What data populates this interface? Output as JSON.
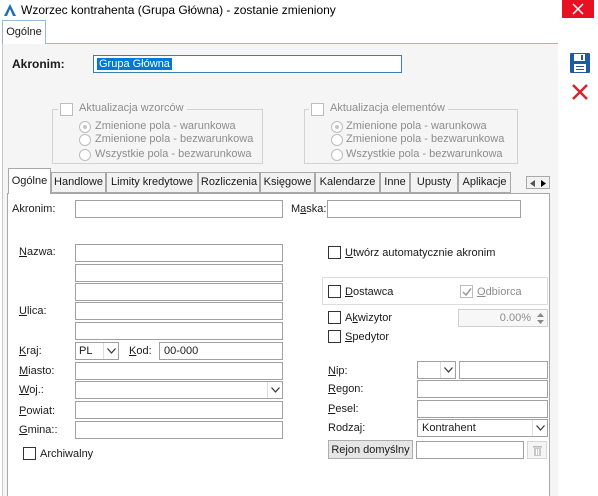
{
  "window": {
    "title": "Wzorzec kontrahenta (Grupa Główna) - zostanie zmieniony"
  },
  "outer_tab": {
    "label": "Ogólne"
  },
  "akronim_top": {
    "label": "Akronim:",
    "value": "Grupa Główna"
  },
  "groups": {
    "wzorcow": {
      "title": "Aktualizacja wzorców",
      "options": [
        "Zmienione pola - warunkowa",
        "Zmienione pola - bezwarunkowa",
        "Wszystkie pola - bezwarunkowa"
      ]
    },
    "elementow": {
      "title": "Aktualizacja elementów",
      "options": [
        "Zmienione pola - warunkowa",
        "Zmienione pola - bezwarunkowa",
        "Wszystkie pola - bezwarunkowa"
      ]
    }
  },
  "tabs": [
    "Ogólne",
    "Handlowe",
    "Limity kredytowe",
    "Rozliczenia",
    "Księgowe",
    "Kalendarze",
    "Inne",
    "Upusty",
    "Aplikacje"
  ],
  "form": {
    "akronim": {
      "pre": "Akronim",
      "post": ":"
    },
    "maska": {
      "pre": "M",
      "ul": "a",
      "post": "ska:"
    },
    "nazwa": {
      "pre": "",
      "ul": "N",
      "post": "azwa:"
    },
    "ulica": {
      "pre": "",
      "ul": "U",
      "post": "lica:"
    },
    "kraj": {
      "pre": "",
      "ul": "K",
      "post": "raj:",
      "value": "PL"
    },
    "kod": {
      "pre": "",
      "ul": "K",
      "post": "od:",
      "value": "00-000"
    },
    "miasto": {
      "pre": "",
      "ul": "M",
      "post": "iasto:"
    },
    "woj": {
      "pre": "",
      "ul": "W",
      "post": "oj.:"
    },
    "powiat": {
      "pre": "",
      "ul": "P",
      "post": "owiat:"
    },
    "gmina": {
      "pre": "",
      "ul": "G",
      "post": "mina::"
    },
    "archiwalny": {
      "label": "Archiwalny"
    },
    "auto_akronim": {
      "pre": "",
      "ul": "U",
      "post": "twórz automatycznie akronim"
    },
    "dostawca": {
      "pre": "",
      "ul": "D",
      "post": "ostawca"
    },
    "odbiorca": {
      "pre": "",
      "ul": "O",
      "post": "dbiorca"
    },
    "akwizytor": {
      "pre": "A",
      "ul": "k",
      "post": "wizytor",
      "value": "0.00%"
    },
    "spedytor": {
      "pre": "",
      "ul": "S",
      "post": "pedytor"
    },
    "nip": {
      "pre": "",
      "ul": "N",
      "post": "ip:"
    },
    "regon": {
      "pre": "",
      "ul": "R",
      "post": "egon:"
    },
    "pesel": {
      "pre": "",
      "ul": "P",
      "post": "esel:"
    },
    "rodzaj": {
      "label": "Rodzaj:",
      "value": "Kontrahent"
    },
    "rejon_button": {
      "label": "Rejon domyślny"
    }
  },
  "icons": {
    "app": "app-logo-icon",
    "close": "close-icon",
    "save": "save-icon",
    "cancel": "cancel-icon"
  },
  "colors": {
    "close_bg": "#e81123",
    "selection": "#0078d7",
    "save_blue": "#1f5aa6",
    "cancel_red": "#d9242b"
  }
}
